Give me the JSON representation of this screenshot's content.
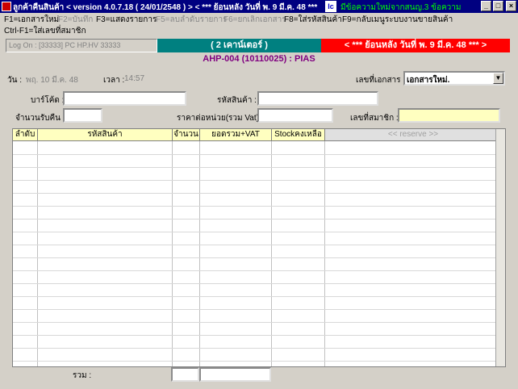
{
  "window": {
    "title": "ลูกค้าคืนสินค้า < version 4.0.7.18 ( 24/01/2548 ) > < *** ย้อนหลัง  วันที่ พ. 9 มี.ค. 48 ***",
    "app_icon_text": "Ic",
    "notice": "มีข้อความใหม่จากสนญ.3 ข้อความ",
    "minimize": "_",
    "maximize": "□",
    "close": "×"
  },
  "menu": [
    {
      "label": "F1=เอกสารใหม่",
      "enabled": true
    },
    {
      "label": "F2=บันทึก",
      "enabled": false
    },
    {
      "label": "F3=แสดงรายการ",
      "enabled": true
    },
    {
      "label": "F5=ลบลำดับรายการ",
      "enabled": false
    },
    {
      "label": "F6=ยกเลิกเอกสาร",
      "enabled": false
    },
    {
      "label": "F8=ใส่รหัสสินค้า",
      "enabled": true
    },
    {
      "label": "F9=กลับเมนูระบบงานขายสินค้า",
      "enabled": true
    }
  ],
  "menu2": "Ctrl-F1=ใส่เลขที่สมาชิก",
  "status": {
    "logon": "Log On : [33333] PC HP.HV 33333",
    "counter": "( 2 เคาน์เตอร์ )",
    "backdate": "< *** ย้อนหลัง  วันที่ พ. 9 มี.ค. 48 *** >",
    "branch": "AHP-004 (10110025)  : PIAS"
  },
  "form": {
    "date_label": "วัน :",
    "date_value": "พฤ. 10 มี.ค. 48",
    "time_label": "เวลา :",
    "time_value": "14:57",
    "docno_label": "เลขที่เอกสาร :",
    "docno_value": "เอกสารใหม่.",
    "barcode_label": "บาร์โค้ด :",
    "product_code_label": "รหัสสินค้า :",
    "qty_return_label": "จำนวนรับคืน :",
    "unit_price_label": "ราคาต่อหน่วย(รวม Vat) :",
    "member_label": "เลขที่สมาชิก :"
  },
  "table": {
    "columns": [
      "ลำดับ",
      "รหัสสินค้า",
      "จำนวน",
      "ยอดรวม+VAT",
      "Stockคงเหลือ",
      "<< reserve >>"
    ]
  },
  "footer": {
    "total_label": "รวม :"
  }
}
